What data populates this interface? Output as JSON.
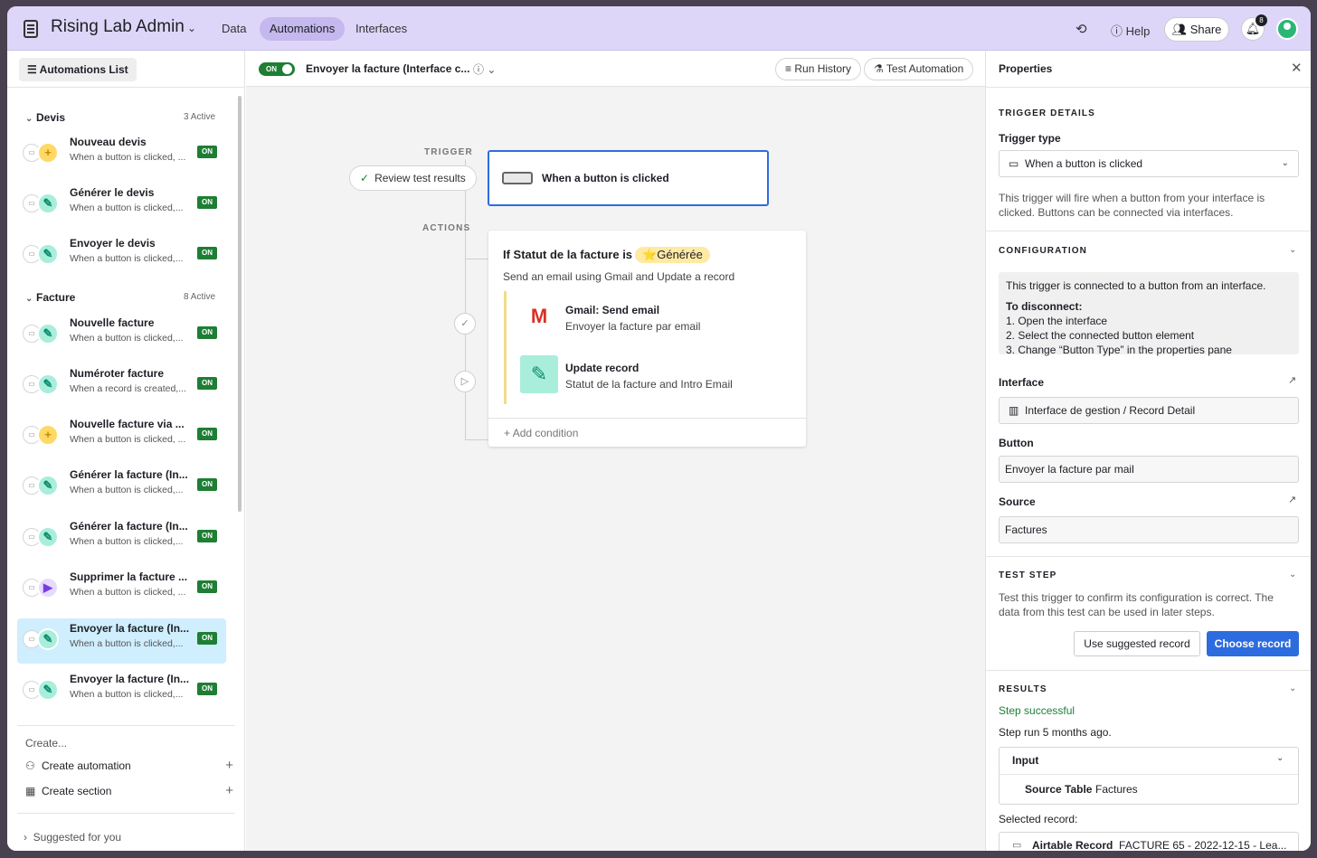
{
  "app": {
    "title": "Rising Lab Admin"
  },
  "nav": {
    "data": "Data",
    "automations": "Automations",
    "interfaces": "Interfaces",
    "help": "Help",
    "share": "Share",
    "notif_count": "8"
  },
  "sidebar": {
    "list_button": "Automations List",
    "sections": [
      {
        "name": "Devis",
        "active": "3 Active"
      },
      {
        "name": "Facture",
        "active": "8 Active"
      }
    ],
    "items": [
      {
        "name": "Nouveau devis",
        "desc": "When a button is clicked, ...",
        "status": "ON",
        "action": "plus"
      },
      {
        "name": "Générer le devis",
        "desc": "When a button is clicked,...",
        "status": "ON",
        "action": "pen"
      },
      {
        "name": "Envoyer le devis",
        "desc": "When a button is clicked,...",
        "status": "ON",
        "action": "pen"
      },
      {
        "name": "Nouvelle facture",
        "desc": "When a button is clicked,...",
        "status": "ON",
        "action": "pen"
      },
      {
        "name": "Numéroter facture",
        "desc": "When a record is created,...",
        "status": "ON",
        "action": "pen"
      },
      {
        "name": "Nouvelle facture via ...",
        "desc": "When a button is clicked, ...",
        "status": "ON",
        "action": "plus"
      },
      {
        "name": "Générer la facture (In...",
        "desc": "When a button is clicked,...",
        "status": "ON",
        "action": "pen"
      },
      {
        "name": "Générer la facture (In...",
        "desc": "When a button is clicked,...",
        "status": "ON",
        "action": "pen"
      },
      {
        "name": "Supprimer la facture ...",
        "desc": "When a button is clicked, ...",
        "status": "ON",
        "action": "play"
      },
      {
        "name": "Envoyer la facture (In...",
        "desc": "When a button is clicked,...",
        "status": "ON",
        "action": "pen"
      },
      {
        "name": "Envoyer la facture (In...",
        "desc": "When a button is clicked,...",
        "status": "ON",
        "action": "pen"
      }
    ],
    "create_label": "Create...",
    "create_automation": "Create automation",
    "create_section": "Create section",
    "suggested": "Suggested for you"
  },
  "automation": {
    "toggle": "ON",
    "title": "Envoyer la facture (Interface c...",
    "run_history": "Run History",
    "test_automation": "Test Automation",
    "trigger_label": "TRIGGER",
    "actions_label": "ACTIONS",
    "review": "Review test results",
    "trigger_text": "When a button is clicked",
    "condition_prefix": "If Statut de la facture is",
    "condition_value": "Générée",
    "condition_star": "⭐",
    "condition_sub": "Send an email using Gmail and Update a record",
    "step1_name": "Gmail: Send email",
    "step1_desc": "Envoyer la facture par email",
    "step2_name": "Update record",
    "step2_desc": "Statut de la facture and Intro Email",
    "add_condition": "Add condition"
  },
  "properties": {
    "title": "Properties",
    "trigger_details": "TRIGGER DETAILS",
    "trigger_type_label": "Trigger type",
    "trigger_type_value": "When a button is clicked",
    "trigger_help": "This trigger will fire when a button from your interface is clicked. Buttons can be connected via interfaces.",
    "configuration": "CONFIGURATION",
    "config_line1": "This trigger is connected to a button from an interface.",
    "config_line2": "To disconnect:",
    "config_line3": "1. Open the interface",
    "config_line4": "2. Select the connected button element",
    "config_line5": "3. Change “Button Type” in the properties pane",
    "interface_label": "Interface",
    "interface_value": "Interface de gestion / Record Detail",
    "button_label": "Button",
    "button_value": "Envoyer la facture par mail",
    "source_label": "Source",
    "source_value": "Factures",
    "test_step": "TEST STEP",
    "test_help": "Test this trigger to confirm its configuration is correct. The data from this test can be used in later steps.",
    "use_suggested": "Use suggested record",
    "choose_record": "Choose record",
    "results": "RESULTS",
    "step_successful": "Step successful",
    "step_run": "Step run 5 months ago.",
    "input": "Input",
    "source_table_label": "Source Table",
    "source_table_value": "Factures",
    "selected_record": "Selected record:",
    "record_label": "Airtable Record",
    "record_value": "FACTURE 65 - 2022-12-15 - Lea..."
  }
}
